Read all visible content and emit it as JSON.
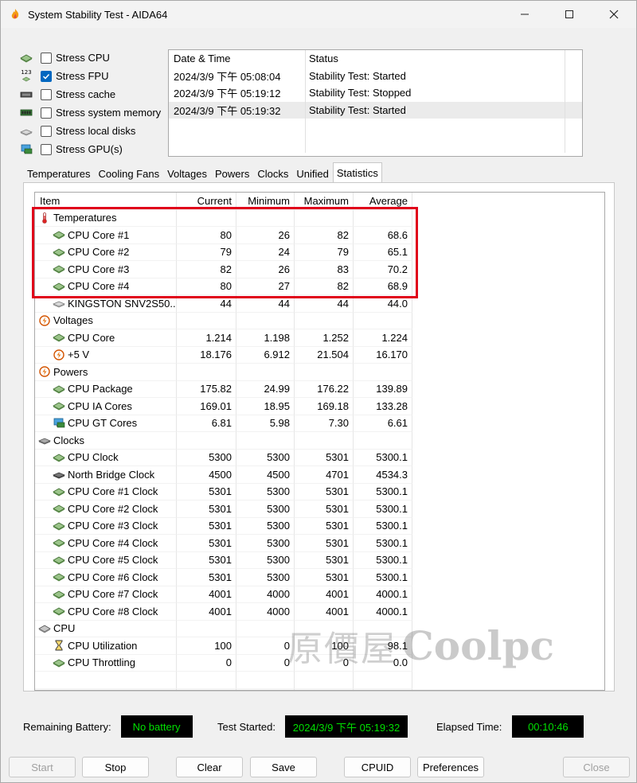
{
  "window": {
    "title": "System Stability Test - AIDA64"
  },
  "stress": [
    {
      "label": "Stress CPU",
      "checked": false,
      "icon": "cpu-chip-icon"
    },
    {
      "label": "Stress FPU",
      "checked": true,
      "icon": "fpu-chip-icon",
      "badge": "123"
    },
    {
      "label": "Stress cache",
      "checked": false,
      "icon": "cache-chip-icon"
    },
    {
      "label": "Stress system memory",
      "checked": false,
      "icon": "memory-module-icon"
    },
    {
      "label": "Stress local disks",
      "checked": false,
      "icon": "disk-drive-icon"
    },
    {
      "label": "Stress GPU(s)",
      "checked": false,
      "icon": "gpu-monitor-icon"
    }
  ],
  "log": {
    "headers": [
      "Date & Time",
      "Status"
    ],
    "rows": [
      [
        "2024/3/9 下午 05:08:04",
        "Stability Test: Started"
      ],
      [
        "2024/3/9 下午 05:19:12",
        "Stability Test: Stopped"
      ],
      [
        "2024/3/9 下午 05:19:32",
        "Stability Test: Started"
      ]
    ]
  },
  "tabs": [
    "Temperatures",
    "Cooling Fans",
    "Voltages",
    "Powers",
    "Clocks",
    "Unified",
    "Statistics"
  ],
  "active_tab": "Statistics",
  "grid": {
    "headers": [
      "Item",
      "Current",
      "Minimum",
      "Maximum",
      "Average"
    ],
    "rows": [
      {
        "kind": "group",
        "icon": "thermometer-icon",
        "item": "Temperatures"
      },
      {
        "kind": "row",
        "icon": "chip-icon",
        "item": "CPU Core #1",
        "cur": "80",
        "min": "26",
        "max": "82",
        "avg": "68.6"
      },
      {
        "kind": "row",
        "icon": "chip-icon",
        "item": "CPU Core #2",
        "cur": "79",
        "min": "24",
        "max": "79",
        "avg": "65.1"
      },
      {
        "kind": "row",
        "icon": "chip-icon",
        "item": "CPU Core #3",
        "cur": "82",
        "min": "26",
        "max": "83",
        "avg": "70.2"
      },
      {
        "kind": "row",
        "icon": "chip-icon",
        "item": "CPU Core #4",
        "cur": "80",
        "min": "27",
        "max": "82",
        "avg": "68.9"
      },
      {
        "kind": "row",
        "icon": "disk-icon",
        "item": "KINGSTON SNV2S50...",
        "cur": "44",
        "min": "44",
        "max": "44",
        "avg": "44.0"
      },
      {
        "kind": "group",
        "icon": "voltage-icon",
        "item": "Voltages"
      },
      {
        "kind": "row",
        "icon": "chip-icon",
        "item": "CPU Core",
        "cur": "1.214",
        "min": "1.198",
        "max": "1.252",
        "avg": "1.224"
      },
      {
        "kind": "row",
        "icon": "voltage-icon",
        "item": "+5 V",
        "cur": "18.176",
        "min": "6.912",
        "max": "21.504",
        "avg": "16.170"
      },
      {
        "kind": "group",
        "icon": "power-icon",
        "item": "Powers"
      },
      {
        "kind": "row",
        "icon": "chip-icon",
        "item": "CPU Package",
        "cur": "175.82",
        "min": "24.99",
        "max": "176.22",
        "avg": "139.89"
      },
      {
        "kind": "row",
        "icon": "chip-icon",
        "item": "CPU IA Cores",
        "cur": "169.01",
        "min": "18.95",
        "max": "169.18",
        "avg": "133.28"
      },
      {
        "kind": "row",
        "icon": "gpu-icon",
        "item": "CPU GT Cores",
        "cur": "6.81",
        "min": "5.98",
        "max": "7.30",
        "avg": "6.61"
      },
      {
        "kind": "group",
        "icon": "clock-chip-icon",
        "item": "Clocks"
      },
      {
        "kind": "row",
        "icon": "chip-icon",
        "item": "CPU Clock",
        "cur": "5300",
        "min": "5300",
        "max": "5301",
        "avg": "5300.1"
      },
      {
        "kind": "row",
        "icon": "northbridge-icon",
        "item": "North Bridge Clock",
        "cur": "4500",
        "min": "4500",
        "max": "4701",
        "avg": "4534.3"
      },
      {
        "kind": "row",
        "icon": "chip-icon",
        "item": "CPU Core #1 Clock",
        "cur": "5301",
        "min": "5300",
        "max": "5301",
        "avg": "5300.1"
      },
      {
        "kind": "row",
        "icon": "chip-icon",
        "item": "CPU Core #2 Clock",
        "cur": "5301",
        "min": "5300",
        "max": "5301",
        "avg": "5300.1"
      },
      {
        "kind": "row",
        "icon": "chip-icon",
        "item": "CPU Core #3 Clock",
        "cur": "5301",
        "min": "5300",
        "max": "5301",
        "avg": "5300.1"
      },
      {
        "kind": "row",
        "icon": "chip-icon",
        "item": "CPU Core #4 Clock",
        "cur": "5301",
        "min": "5300",
        "max": "5301",
        "avg": "5300.1"
      },
      {
        "kind": "row",
        "icon": "chip-icon",
        "item": "CPU Core #5 Clock",
        "cur": "5301",
        "min": "5300",
        "max": "5301",
        "avg": "5300.1"
      },
      {
        "kind": "row",
        "icon": "chip-icon",
        "item": "CPU Core #6 Clock",
        "cur": "5301",
        "min": "5300",
        "max": "5301",
        "avg": "5300.1"
      },
      {
        "kind": "row",
        "icon": "chip-icon",
        "item": "CPU Core #7 Clock",
        "cur": "4001",
        "min": "4000",
        "max": "4001",
        "avg": "4000.1"
      },
      {
        "kind": "row",
        "icon": "chip-icon",
        "item": "CPU Core #8 Clock",
        "cur": "4001",
        "min": "4000",
        "max": "4001",
        "avg": "4000.1"
      },
      {
        "kind": "group",
        "icon": "cpu-group-icon",
        "item": "CPU"
      },
      {
        "kind": "row",
        "icon": "hourglass-icon",
        "item": "CPU Utilization",
        "cur": "100",
        "min": "0",
        "max": "100",
        "avg": "98.1"
      },
      {
        "kind": "row",
        "icon": "chip-icon",
        "item": "CPU Throttling",
        "cur": "0",
        "min": "0",
        "max": "0",
        "avg": "0.0"
      }
    ]
  },
  "status": {
    "battery_label": "Remaining Battery:",
    "battery_value": "No battery",
    "started_label": "Test Started:",
    "started_value": "2024/3/9 下午 05:19:32",
    "elapsed_label": "Elapsed Time:",
    "elapsed_value": "00:10:46"
  },
  "buttons": {
    "start": "Start",
    "stop": "Stop",
    "clear": "Clear",
    "save": "Save",
    "cpuid": "CPUID",
    "preferences": "Preferences",
    "close": "Close"
  },
  "watermark": {
    "cn": "原價屋",
    "en": "Coolpc"
  },
  "colors": {
    "lcd_text": "#00e000",
    "highlight": "#e0001a",
    "checkbox": "#0067c0"
  }
}
